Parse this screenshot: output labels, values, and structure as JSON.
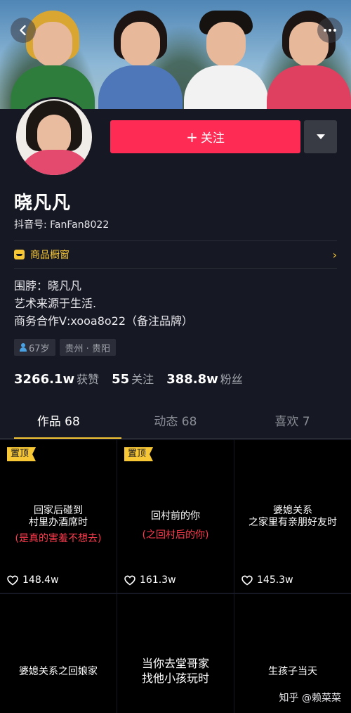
{
  "header": {
    "back_icon": "chevron-left-icon",
    "more_icon": "more-dots-icon"
  },
  "profile": {
    "name": "晓凡凡",
    "douyin_id": "抖音号: FanFan8022",
    "follow_label": "关注",
    "follow_plus": "+",
    "shop_label": "商品橱窗",
    "bio_lines": [
      "围脖：晓凡凡",
      "艺术来源于生活.",
      "商务合作Ⅴ:xooa8o22（备注品牌）"
    ],
    "tags": [
      "67岁",
      "贵州 · 贵阳"
    ],
    "accent": "#fe2c55",
    "gold": "#f7c736"
  },
  "stats": [
    {
      "num": "3266.1w",
      "label": "获赞"
    },
    {
      "num": "55",
      "label": "关注"
    },
    {
      "num": "388.8w",
      "label": "粉丝"
    }
  ],
  "tabs": [
    {
      "label": "作品 68",
      "active": true
    },
    {
      "label": "动态 68",
      "active": false
    },
    {
      "label": "喜欢 7",
      "active": false
    }
  ],
  "videos": [
    {
      "pinned": "置顶",
      "line1": "回家后碰到",
      "line2": "村里办酒席时",
      "sub": "(是真的害羞不想去)",
      "likes": "148.4w"
    },
    {
      "pinned": "置顶",
      "line1": "回村前的你",
      "line2": "",
      "sub": "(之回村后的你)",
      "likes": "161.3w"
    },
    {
      "pinned": "",
      "line1": "婆媳关系",
      "line2": "之家里有亲朋好友时",
      "sub": "",
      "likes": "145.3w"
    },
    {
      "line1": "婆媳关系之回娘家",
      "line2": ""
    },
    {
      "line1": "当你去堂哥家",
      "line2": "找他小孩玩时"
    },
    {
      "line1": "生孩子当天",
      "line2": ""
    }
  ],
  "watermark": "知乎 @赖菜菜"
}
